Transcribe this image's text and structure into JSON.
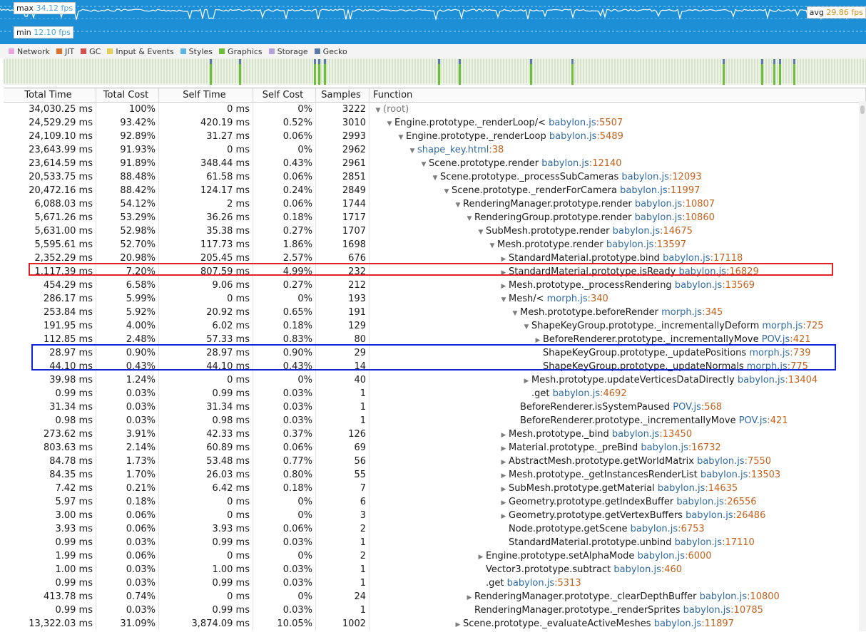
{
  "fps": {
    "max_label": "max",
    "max_value": "34.12",
    "max_unit": "fps",
    "min_label": "min",
    "min_value": "12.10",
    "min_unit": "fps",
    "avg_label": "avg",
    "avg_value": "29.86",
    "avg_unit": "fps"
  },
  "legend": [
    {
      "label": "Network",
      "color": "#e9a4e6"
    },
    {
      "label": "JIT",
      "color": "#e0702d"
    },
    {
      "label": "GC",
      "color": "#d94f4f"
    },
    {
      "label": "Input & Events",
      "color": "#e6cf57"
    },
    {
      "label": "Styles",
      "color": "#59b5e6"
    },
    {
      "label": "Graphics",
      "color": "#6fbe3b"
    },
    {
      "label": "Storage",
      "color": "#b4a1d9"
    },
    {
      "label": "Gecko",
      "color": "#5c7aaa"
    }
  ],
  "columns": [
    "Total Time",
    "Total Cost",
    "Self Time",
    "Self Cost",
    "Samples",
    "Function"
  ],
  "rows": [
    {
      "total": "34,030.25 ms",
      "tcost": "100%",
      "self": "0 ms",
      "scost": "0%",
      "samples": "3222",
      "depth": 0,
      "tw": "open",
      "fn": "(root)",
      "file": "",
      "line": "",
      "kind": "root"
    },
    {
      "total": "24,529.29 ms",
      "tcost": "93.42%",
      "self": "420.19 ms",
      "scost": "0.52%",
      "samples": "3010",
      "depth": 1,
      "tw": "open",
      "fn": "Engine.prototype._renderLoop/<",
      "file": "babylon.js",
      "line": "5507",
      "kind": ""
    },
    {
      "total": "24,109.10 ms",
      "tcost": "92.89%",
      "self": "31.27 ms",
      "scost": "0.06%",
      "samples": "2993",
      "depth": 2,
      "tw": "open",
      "fn": "Engine.prototype._renderLoop",
      "file": "babylon.js",
      "line": "5489",
      "kind": ""
    },
    {
      "total": "23,643.99 ms",
      "tcost": "91.93%",
      "self": "0 ms",
      "scost": "0%",
      "samples": "2962",
      "depth": 3,
      "tw": "open",
      "fn": "shape_key.html",
      "file": "",
      "line": "38",
      "kind": "blue"
    },
    {
      "total": "23,614.59 ms",
      "tcost": "91.89%",
      "self": "348.44 ms",
      "scost": "0.43%",
      "samples": "2961",
      "depth": 4,
      "tw": "open",
      "fn": "Scene.prototype.render",
      "file": "babylon.js",
      "line": "12140",
      "kind": ""
    },
    {
      "total": "20,533.75 ms",
      "tcost": "88.48%",
      "self": "61.58 ms",
      "scost": "0.06%",
      "samples": "2851",
      "depth": 5,
      "tw": "open",
      "fn": "Scene.prototype._processSubCameras",
      "file": "babylon.js",
      "line": "12093",
      "kind": ""
    },
    {
      "total": "20,472.16 ms",
      "tcost": "88.42%",
      "self": "124.17 ms",
      "scost": "0.24%",
      "samples": "2849",
      "depth": 6,
      "tw": "open",
      "fn": "Scene.prototype._renderForCamera",
      "file": "babylon.js",
      "line": "11997",
      "kind": ""
    },
    {
      "total": "6,088.03 ms",
      "tcost": "54.12%",
      "self": "2 ms",
      "scost": "0.06%",
      "samples": "1744",
      "depth": 7,
      "tw": "open",
      "fn": "RenderingManager.prototype.render",
      "file": "babylon.js",
      "line": "10807",
      "kind": ""
    },
    {
      "total": "5,671.26 ms",
      "tcost": "53.29%",
      "self": "36.26 ms",
      "scost": "0.18%",
      "samples": "1717",
      "depth": 8,
      "tw": "open",
      "fn": "RenderingGroup.prototype.render",
      "file": "babylon.js",
      "line": "10860",
      "kind": ""
    },
    {
      "total": "5,631.00 ms",
      "tcost": "52.98%",
      "self": "35.38 ms",
      "scost": "0.27%",
      "samples": "1707",
      "depth": 9,
      "tw": "open",
      "fn": "SubMesh.prototype.render",
      "file": "babylon.js",
      "line": "14675",
      "kind": ""
    },
    {
      "total": "5,595.61 ms",
      "tcost": "52.70%",
      "self": "117.73 ms",
      "scost": "1.86%",
      "samples": "1698",
      "depth": 10,
      "tw": "open",
      "fn": "Mesh.prototype.render",
      "file": "babylon.js",
      "line": "13597",
      "kind": ""
    },
    {
      "total": "2,352.29 ms",
      "tcost": "20.98%",
      "self": "205.45 ms",
      "scost": "2.57%",
      "samples": "676",
      "depth": 11,
      "tw": "closed",
      "fn": "StandardMaterial.prototype.bind",
      "file": "babylon.js",
      "line": "17118",
      "kind": ""
    },
    {
      "total": "1,117.39 ms",
      "tcost": "7.20%",
      "self": "807.59 ms",
      "scost": "4.99%",
      "samples": "232",
      "depth": 11,
      "tw": "closed",
      "fn": "StandardMaterial.prototype.isReady",
      "file": "babylon.js",
      "line": "16829",
      "kind": ""
    },
    {
      "total": "454.29 ms",
      "tcost": "6.58%",
      "self": "9.06 ms",
      "scost": "0.27%",
      "samples": "212",
      "depth": 11,
      "tw": "closed",
      "fn": "Mesh.prototype._processRendering",
      "file": "babylon.js",
      "line": "13569",
      "kind": ""
    },
    {
      "total": "286.17 ms",
      "tcost": "5.99%",
      "self": "0 ms",
      "scost": "0%",
      "samples": "193",
      "depth": 11,
      "tw": "open",
      "fn": "Mesh/<",
      "file": "morph.js",
      "line": "340",
      "kind": ""
    },
    {
      "total": "253.84 ms",
      "tcost": "5.92%",
      "self": "20.92 ms",
      "scost": "0.65%",
      "samples": "191",
      "depth": 12,
      "tw": "open",
      "fn": "Mesh.prototype.beforeRender",
      "file": "morph.js",
      "line": "345",
      "kind": ""
    },
    {
      "total": "191.95 ms",
      "tcost": "4.00%",
      "self": "6.02 ms",
      "scost": "0.18%",
      "samples": "129",
      "depth": 13,
      "tw": "open",
      "fn": "ShapeKeyGroup.prototype._incrementallyDeform",
      "file": "morph.js",
      "line": "725",
      "kind": ""
    },
    {
      "total": "112.85 ms",
      "tcost": "2.48%",
      "self": "57.33 ms",
      "scost": "0.83%",
      "samples": "80",
      "depth": 14,
      "tw": "closed",
      "fn": "BeforeRenderer.prototype._incrementallyMove",
      "file": "POV.js",
      "line": "421",
      "kind": ""
    },
    {
      "total": "28.97 ms",
      "tcost": "0.90%",
      "self": "28.97 ms",
      "scost": "0.90%",
      "samples": "29",
      "depth": 14,
      "tw": "none",
      "fn": "ShapeKeyGroup.prototype._updatePositions",
      "file": "morph.js",
      "line": "739",
      "kind": ""
    },
    {
      "total": "44.10 ms",
      "tcost": "0.43%",
      "self": "44.10 ms",
      "scost": "0.43%",
      "samples": "14",
      "depth": 14,
      "tw": "none",
      "fn": "ShapeKeyGroup.prototype._updateNormals",
      "file": "morph.js",
      "line": "775",
      "kind": ""
    },
    {
      "total": "39.98 ms",
      "tcost": "1.24%",
      "self": "0 ms",
      "scost": "0%",
      "samples": "40",
      "depth": 13,
      "tw": "closed",
      "fn": "Mesh.prototype.updateVerticesDataDirectly",
      "file": "babylon.js",
      "line": "13404",
      "kind": ""
    },
    {
      "total": "0.99 ms",
      "tcost": "0.03%",
      "self": "0.99 ms",
      "scost": "0.03%",
      "samples": "1",
      "depth": 13,
      "tw": "none",
      "fn": ".get",
      "file": "babylon.js",
      "line": "4692",
      "kind": ""
    },
    {
      "total": "31.34 ms",
      "tcost": "0.03%",
      "self": "31.34 ms",
      "scost": "0.03%",
      "samples": "1",
      "depth": 12,
      "tw": "none",
      "fn": "BeforeRenderer.isSystemPaused",
      "file": "POV.js",
      "line": "568",
      "kind": ""
    },
    {
      "total": "0.98 ms",
      "tcost": "0.03%",
      "self": "0.98 ms",
      "scost": "0.03%",
      "samples": "1",
      "depth": 12,
      "tw": "none",
      "fn": "BeforeRenderer.prototype._incrementallyMove",
      "file": "POV.js",
      "line": "421",
      "kind": ""
    },
    {
      "total": "273.62 ms",
      "tcost": "3.91%",
      "self": "42.33 ms",
      "scost": "0.37%",
      "samples": "126",
      "depth": 11,
      "tw": "closed",
      "fn": "Mesh.prototype._bind",
      "file": "babylon.js",
      "line": "13450",
      "kind": ""
    },
    {
      "total": "803.63 ms",
      "tcost": "2.14%",
      "self": "60.89 ms",
      "scost": "0.06%",
      "samples": "69",
      "depth": 11,
      "tw": "closed",
      "fn": "Material.prototype._preBind",
      "file": "babylon.js",
      "line": "16732",
      "kind": ""
    },
    {
      "total": "84.78 ms",
      "tcost": "1.73%",
      "self": "53.48 ms",
      "scost": "0.77%",
      "samples": "56",
      "depth": 11,
      "tw": "closed",
      "fn": "AbstractMesh.prototype.getWorldMatrix",
      "file": "babylon.js",
      "line": "7550",
      "kind": ""
    },
    {
      "total": "84.35 ms",
      "tcost": "1.70%",
      "self": "26.03 ms",
      "scost": "0.80%",
      "samples": "55",
      "depth": 11,
      "tw": "closed",
      "fn": "Mesh.prototype._getInstancesRenderList",
      "file": "babylon.js",
      "line": "13503",
      "kind": ""
    },
    {
      "total": "7.42 ms",
      "tcost": "0.21%",
      "self": "6.42 ms",
      "scost": "0.18%",
      "samples": "7",
      "depth": 11,
      "tw": "closed",
      "fn": "SubMesh.prototype.getMaterial",
      "file": "babylon.js",
      "line": "14635",
      "kind": ""
    },
    {
      "total": "5.97 ms",
      "tcost": "0.18%",
      "self": "0 ms",
      "scost": "0%",
      "samples": "6",
      "depth": 11,
      "tw": "closed",
      "fn": "Geometry.prototype.getIndexBuffer",
      "file": "babylon.js",
      "line": "26556",
      "kind": ""
    },
    {
      "total": "3.00 ms",
      "tcost": "0.06%",
      "self": "0 ms",
      "scost": "0%",
      "samples": "3",
      "depth": 11,
      "tw": "closed",
      "fn": "Geometry.prototype.getVertexBuffers",
      "file": "babylon.js",
      "line": "26486",
      "kind": ""
    },
    {
      "total": "3.93 ms",
      "tcost": "0.06%",
      "self": "3.93 ms",
      "scost": "0.06%",
      "samples": "2",
      "depth": 11,
      "tw": "none",
      "fn": "Node.prototype.getScene",
      "file": "babylon.js",
      "line": "6753",
      "kind": ""
    },
    {
      "total": "0.99 ms",
      "tcost": "0.03%",
      "self": "0.99 ms",
      "scost": "0.03%",
      "samples": "1",
      "depth": 11,
      "tw": "none",
      "fn": "StandardMaterial.prototype.unbind",
      "file": "babylon.js",
      "line": "17110",
      "kind": ""
    },
    {
      "total": "1.99 ms",
      "tcost": "0.06%",
      "self": "0 ms",
      "scost": "0%",
      "samples": "2",
      "depth": 9,
      "tw": "closed",
      "fn": "Engine.prototype.setAlphaMode",
      "file": "babylon.js",
      "line": "6000",
      "kind": ""
    },
    {
      "total": "1.00 ms",
      "tcost": "0.03%",
      "self": "1.00 ms",
      "scost": "0.03%",
      "samples": "1",
      "depth": 9,
      "tw": "none",
      "fn": "Vector3.prototype.subtract",
      "file": "babylon.js",
      "line": "460",
      "kind": ""
    },
    {
      "total": "0.99 ms",
      "tcost": "0.03%",
      "self": "0.99 ms",
      "scost": "0.03%",
      "samples": "1",
      "depth": 9,
      "tw": "none",
      "fn": ".get",
      "file": "babylon.js",
      "line": "5313",
      "kind": ""
    },
    {
      "total": "413.78 ms",
      "tcost": "0.74%",
      "self": "0 ms",
      "scost": "0%",
      "samples": "24",
      "depth": 8,
      "tw": "closed",
      "fn": "RenderingManager.prototype._clearDepthBuffer",
      "file": "babylon.js",
      "line": "10800",
      "kind": ""
    },
    {
      "total": "0.99 ms",
      "tcost": "0.03%",
      "self": "0.99 ms",
      "scost": "0.03%",
      "samples": "1",
      "depth": 8,
      "tw": "none",
      "fn": "RenderingManager.prototype._renderSprites",
      "file": "babylon.js",
      "line": "10785",
      "kind": ""
    },
    {
      "total": "13,322.03 ms",
      "tcost": "31.09%",
      "self": "3,874.09 ms",
      "scost": "10.05%",
      "samples": "1002",
      "depth": 7,
      "tw": "closed",
      "fn": "Scene.prototype._evaluateActiveMeshes",
      "file": "babylon.js",
      "line": "11897",
      "kind": ""
    }
  ]
}
